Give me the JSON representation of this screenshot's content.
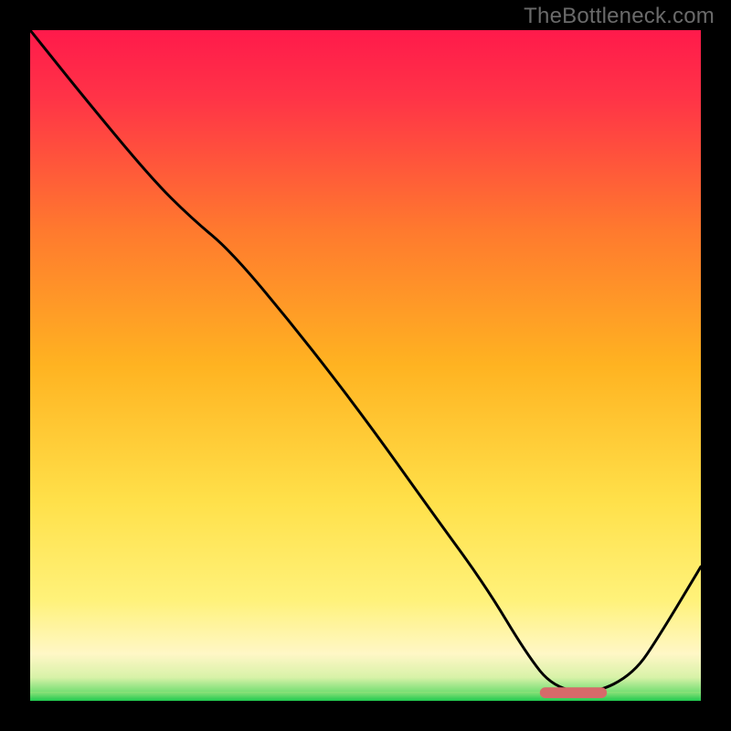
{
  "watermark": "TheBottleneck.com",
  "chart_data": {
    "type": "line",
    "title": "",
    "xlabel": "",
    "ylabel": "",
    "xlim": [
      0,
      100
    ],
    "ylim": [
      0,
      100
    ],
    "gradient": [
      {
        "offset": 0.0,
        "color": "#ff1a4b"
      },
      {
        "offset": 0.1,
        "color": "#ff3347"
      },
      {
        "offset": 0.3,
        "color": "#ff7a2e"
      },
      {
        "offset": 0.5,
        "color": "#ffb321"
      },
      {
        "offset": 0.7,
        "color": "#ffe049"
      },
      {
        "offset": 0.85,
        "color": "#fff27a"
      },
      {
        "offset": 0.93,
        "color": "#fff7c6"
      },
      {
        "offset": 0.965,
        "color": "#d8f2a8"
      },
      {
        "offset": 0.985,
        "color": "#7fe078"
      },
      {
        "offset": 1.0,
        "color": "#1fc94f"
      }
    ],
    "series": [
      {
        "name": "bottleneck-curve",
        "x": [
          0,
          8,
          18,
          24,
          30,
          40,
          50,
          60,
          68,
          74,
          78,
          84,
          90,
          94,
          100
        ],
        "y": [
          100,
          90,
          78,
          72,
          67,
          55,
          42,
          28,
          17,
          7,
          2,
          1,
          4,
          10,
          20
        ]
      }
    ],
    "marker": {
      "x_start": 76,
      "x_end": 86,
      "y": 1.2,
      "color": "#d66a6a",
      "thickness": 1.6
    }
  }
}
